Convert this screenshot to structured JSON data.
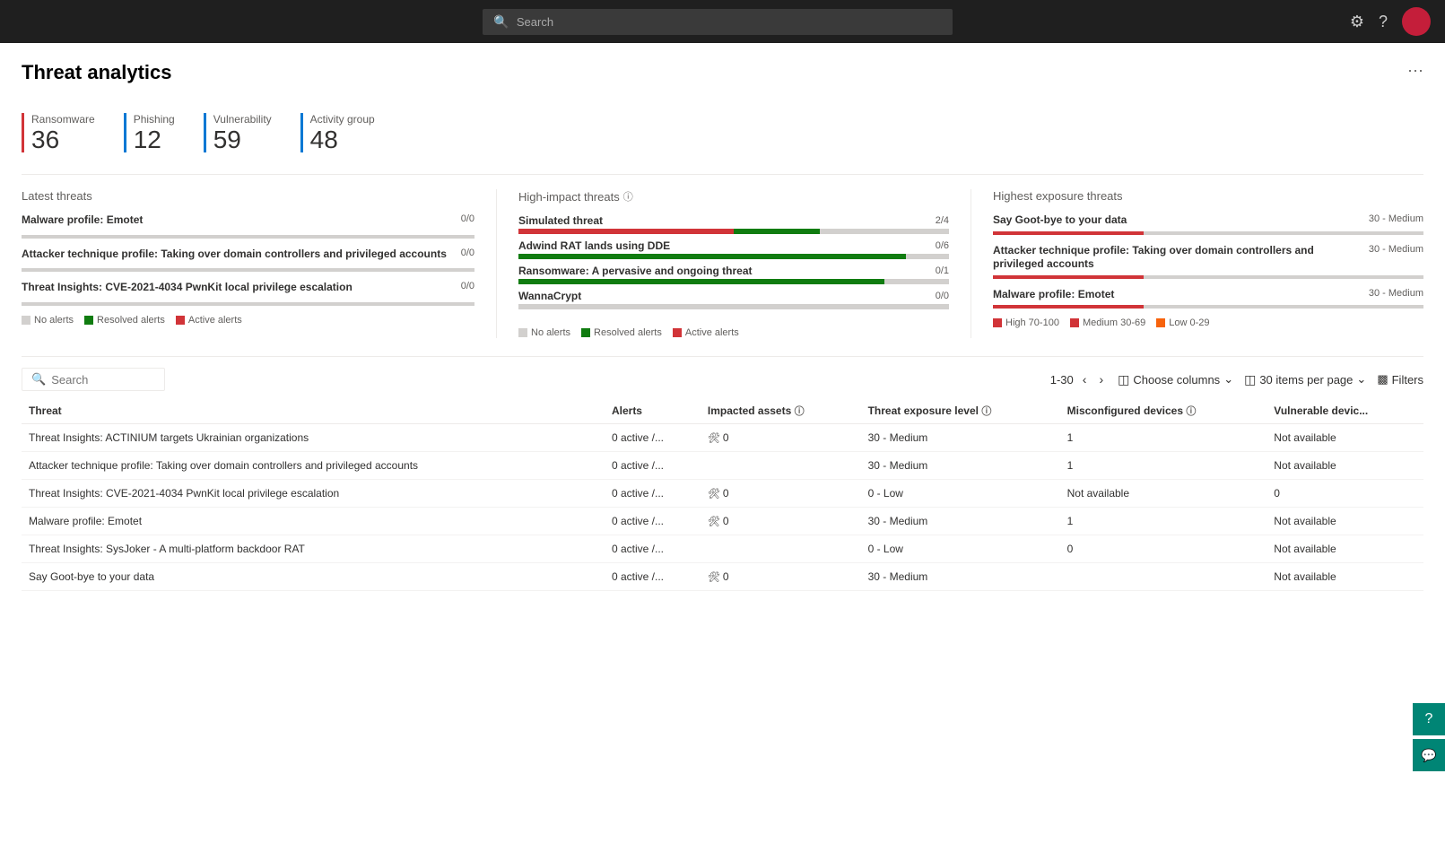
{
  "topbar": {
    "search_placeholder": "Search"
  },
  "page": {
    "title": "Threat analytics",
    "more_icon": "···"
  },
  "stats": [
    {
      "label": "Ransomware",
      "value": "36",
      "border": "red"
    },
    {
      "label": "Phishing",
      "value": "12",
      "border": "blue"
    },
    {
      "label": "Vulnerability",
      "value": "59",
      "border": "blue"
    },
    {
      "label": "Activity group",
      "value": "48",
      "border": "blue"
    }
  ],
  "latest_threats": {
    "title": "Latest threats",
    "items": [
      {
        "name": "Malware profile: Emotet",
        "count": "0/0",
        "bar_pct": 0
      },
      {
        "name": "Attacker technique profile: Taking over domain controllers and privileged accounts",
        "count": "0/0",
        "bar_pct": 0
      },
      {
        "name": "Threat Insights: CVE-2021-4034 PwnKit local privilege escalation",
        "count": "0/0",
        "bar_pct": 0
      }
    ],
    "legend": [
      {
        "label": "No alerts",
        "color": "gray"
      },
      {
        "label": "Resolved alerts",
        "color": "green"
      },
      {
        "label": "Active alerts",
        "color": "red"
      }
    ]
  },
  "high_impact_threats": {
    "title": "High-impact threats",
    "items": [
      {
        "name": "Simulated threat",
        "count": "2/4",
        "red_pct": 50,
        "green_pct": 70
      },
      {
        "name": "Adwind RAT lands using DDE",
        "count": "0/6",
        "red_pct": 0,
        "green_pct": 90
      },
      {
        "name": "Ransomware: A pervasive and ongoing threat",
        "count": "0/1",
        "red_pct": 0,
        "green_pct": 85
      },
      {
        "name": "WannaCrypt",
        "count": "0/0",
        "red_pct": 0,
        "green_pct": 0
      }
    ],
    "legend": [
      {
        "label": "No alerts",
        "color": "gray"
      },
      {
        "label": "Resolved alerts",
        "color": "green"
      },
      {
        "label": "Active alerts",
        "color": "red"
      }
    ]
  },
  "highest_exposure": {
    "title": "Highest exposure threats",
    "items": [
      {
        "name": "Say Goot-bye to your data",
        "level": "30 - Medium",
        "bar_pct": 30
      },
      {
        "name": "Attacker technique profile: Taking over domain controllers and privileged accounts",
        "level": "30 - Medium",
        "bar_pct": 30
      },
      {
        "name": "Malware profile: Emotet",
        "level": "30 - Medium",
        "bar_pct": 30
      }
    ],
    "legend": [
      {
        "label": "High 70-100",
        "color": "red"
      },
      {
        "label": "Medium 30-69",
        "color": "darkred"
      },
      {
        "label": "Low 0-29",
        "color": "orange"
      }
    ]
  },
  "table": {
    "search_placeholder": "Search",
    "pagination": "1-30",
    "choose_columns_label": "Choose columns",
    "items_per_page_label": "30 items per page",
    "filters_label": "Filters",
    "columns": [
      {
        "key": "threat",
        "label": "Threat"
      },
      {
        "key": "alerts",
        "label": "Alerts"
      },
      {
        "key": "impacted",
        "label": "Impacted assets"
      },
      {
        "key": "exposure",
        "label": "Threat exposure level"
      },
      {
        "key": "misconfigured",
        "label": "Misconfigured devices"
      },
      {
        "key": "vulnerable",
        "label": "Vulnerable devic..."
      }
    ],
    "rows": [
      {
        "threat": "Threat Insights: ACTINIUM targets Ukrainian organizations",
        "is_link": true,
        "alerts": "0 active /...",
        "impacted": "0",
        "exposure": "30 - Medium",
        "misconfigured": "1",
        "vulnerable": "Not available"
      },
      {
        "threat": "Attacker technique profile: Taking over domain controllers and privileged accounts",
        "is_link": false,
        "alerts": "0 active /...",
        "impacted": "",
        "exposure": "30 - Medium",
        "misconfigured": "1",
        "vulnerable": "Not available"
      },
      {
        "threat": "Threat Insights: CVE-2021-4034 PwnKit local privilege escalation",
        "is_link": true,
        "alerts": "0 active /...",
        "impacted": "0",
        "exposure": "0 - Low",
        "misconfigured": "Not available",
        "vulnerable": "0"
      },
      {
        "threat": "Malware profile: Emotet",
        "is_link": false,
        "alerts": "0 active /...",
        "impacted": "0",
        "exposure": "30 - Medium",
        "misconfigured": "1",
        "vulnerable": "Not available"
      },
      {
        "threat": "Threat Insights: SysJoker - A multi-platform backdoor RAT",
        "is_link": true,
        "alerts": "0 active /...",
        "impacted": "",
        "exposure": "0 - Low",
        "misconfigured": "0",
        "vulnerable": "Not available"
      },
      {
        "threat": "Say Goot-bye to your data",
        "is_link": false,
        "alerts": "0 active /...",
        "impacted": "0",
        "exposure": "30 - Medium",
        "misconfigured": "",
        "vulnerable": "Not available"
      }
    ]
  },
  "help_icon": "?",
  "chat_icon": "💬"
}
